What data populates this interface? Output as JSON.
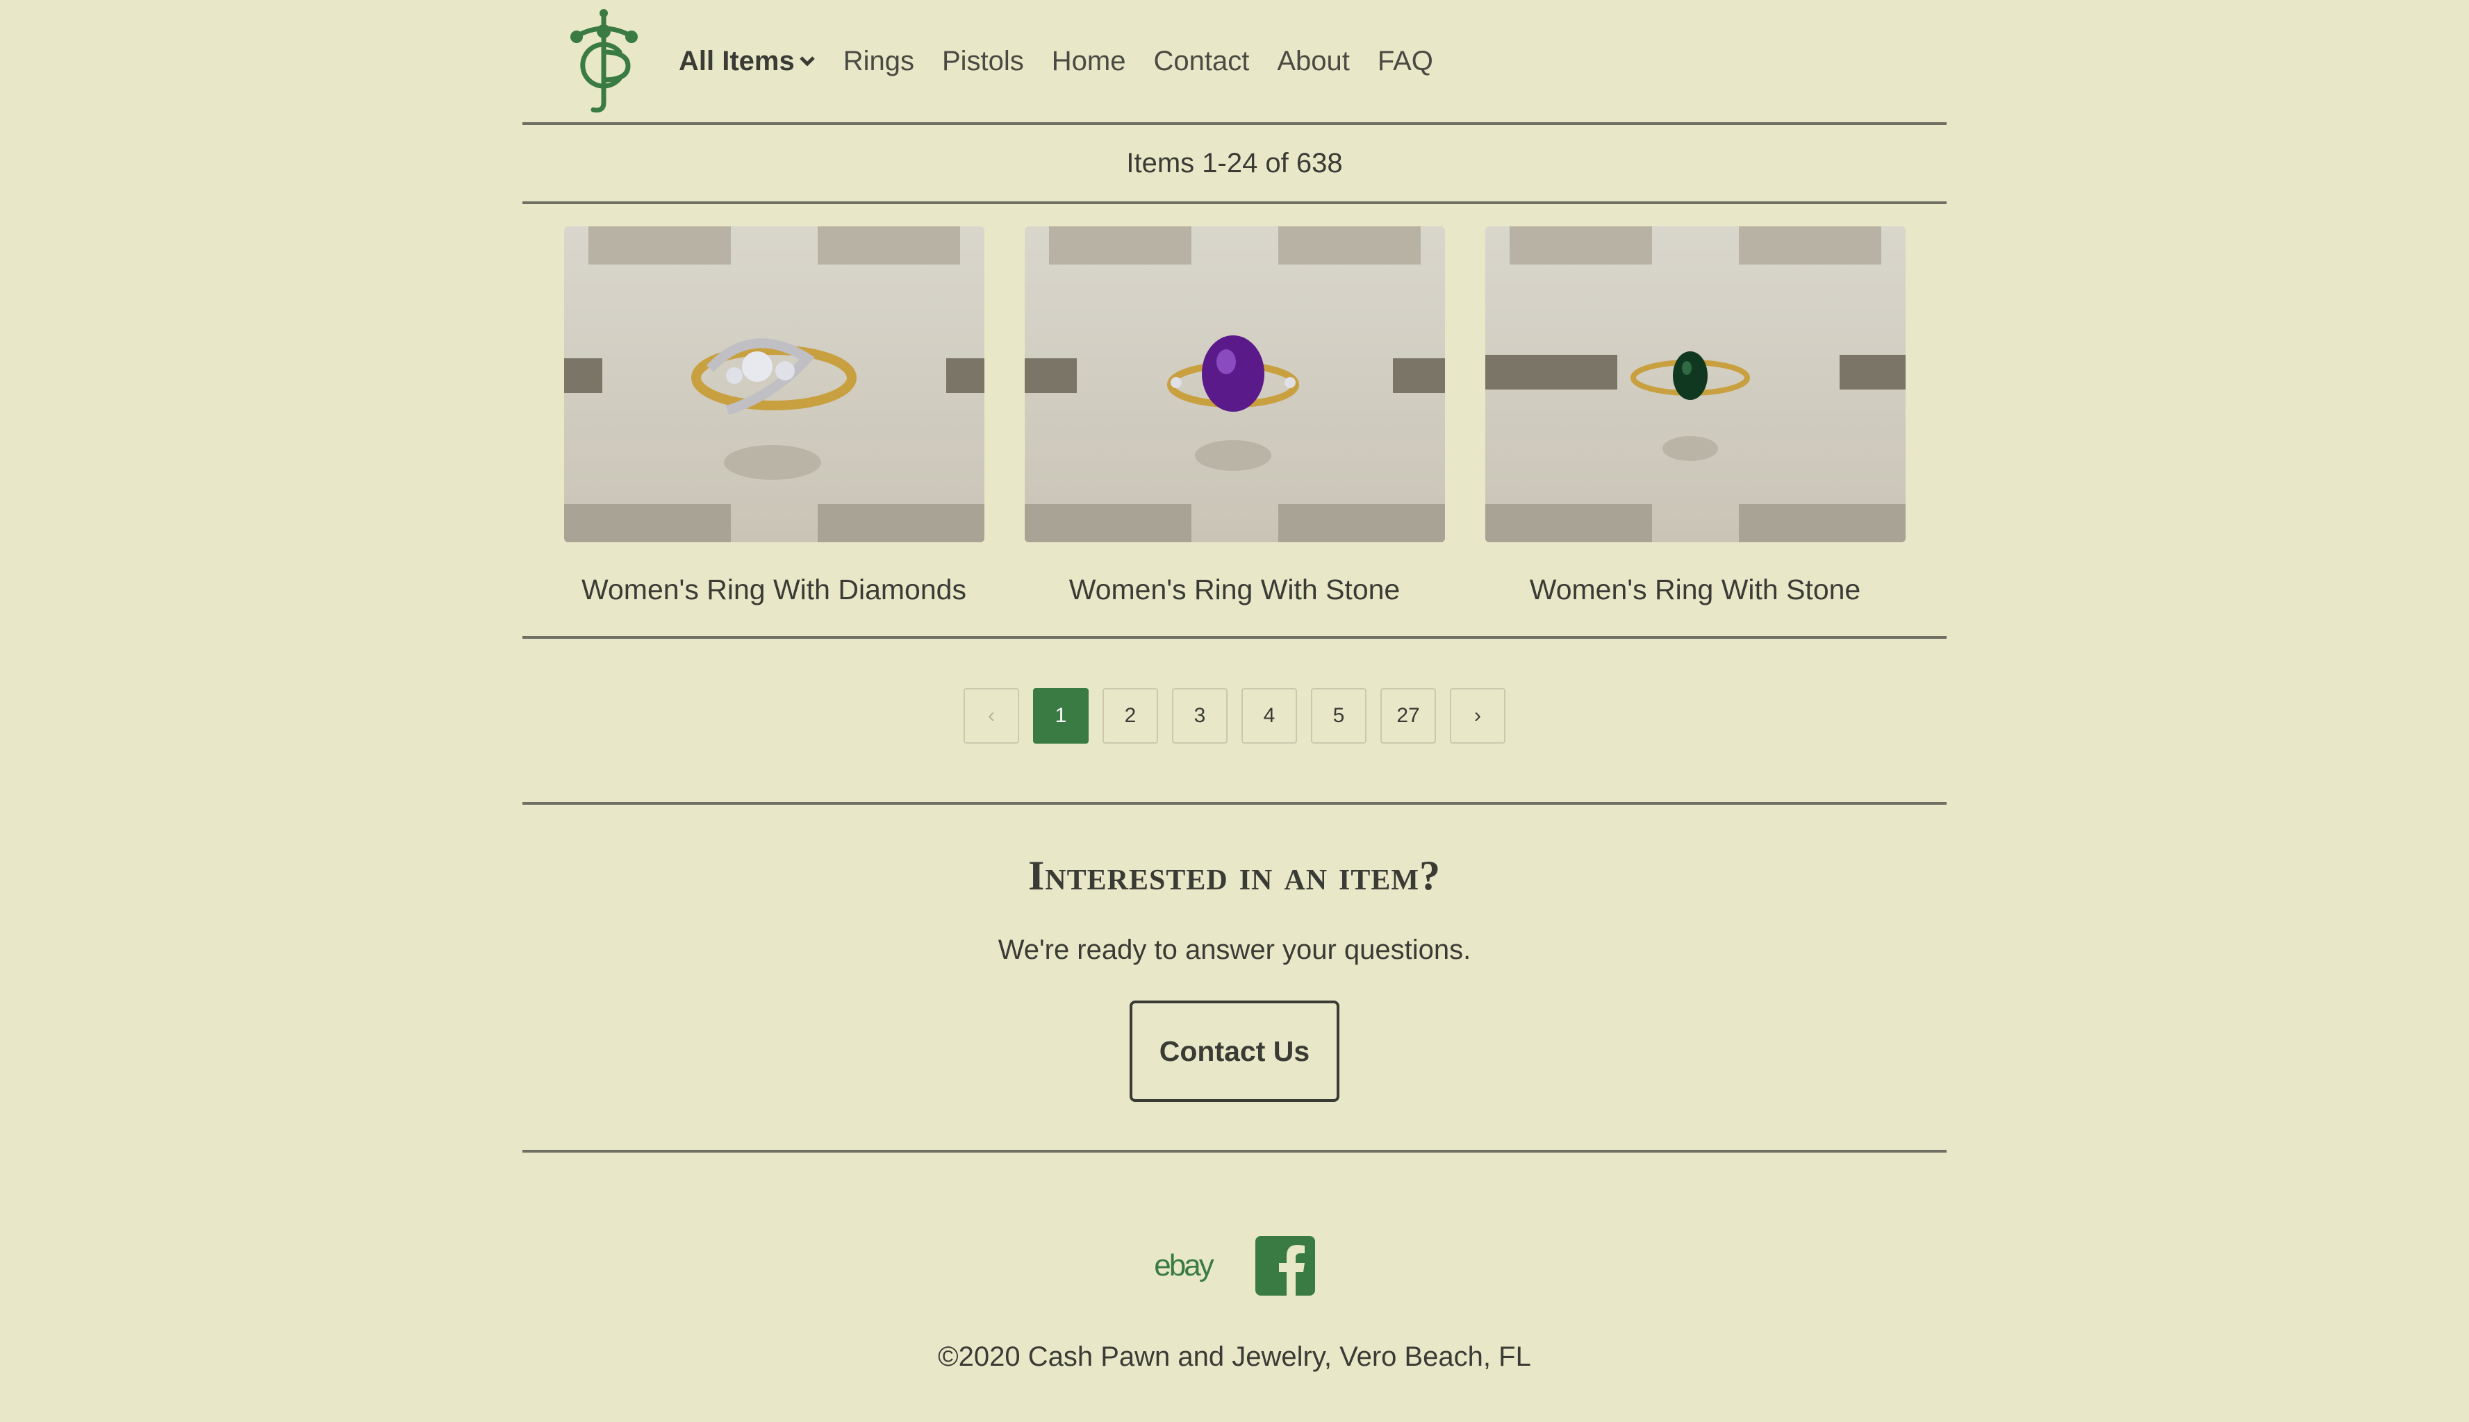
{
  "nav": {
    "items": [
      {
        "label": "All Items",
        "has_dropdown": true
      },
      {
        "label": "Rings"
      },
      {
        "label": "Pistols"
      },
      {
        "label": "Home"
      },
      {
        "label": "Contact"
      },
      {
        "label": "About"
      },
      {
        "label": "FAQ"
      }
    ]
  },
  "listing": {
    "count_text": "Items 1-24 of 638",
    "products": [
      {
        "title": "Women's Ring With Diamonds",
        "stone_color": "#d8d8e0"
      },
      {
        "title": "Women's Ring With Stone",
        "stone_color": "#5a1a8a"
      },
      {
        "title": "Women's Ring With Stone",
        "stone_color": "#103820"
      }
    ]
  },
  "pagination": {
    "prev": "‹",
    "pages": [
      "1",
      "2",
      "3",
      "4",
      "5",
      "27"
    ],
    "active": "1",
    "next": "›"
  },
  "cta": {
    "title": "Interested in an item?",
    "subtitle": "We're ready to answer your questions.",
    "button": "Contact Us"
  },
  "footer": {
    "ebay": "ebay",
    "copyright": "©2020 Cash Pawn and Jewelry, Vero Beach, FL"
  },
  "colors": {
    "background": "#e8e8c9",
    "accent_green": "#3a7a43",
    "text": "#3b3b35",
    "divider": "#6f6f64"
  }
}
